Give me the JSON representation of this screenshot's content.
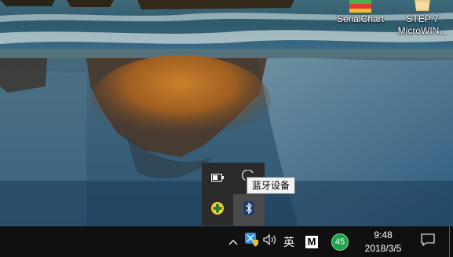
{
  "desktop": {
    "icons": [
      {
        "label": "SerialChart"
      },
      {
        "label_line1": "STEP 7",
        "label_line2": "MicroWIN..."
      }
    ]
  },
  "tray_flyout": {
    "items": [
      "battery-icon",
      "power-ring-icon",
      "green-plus-icon",
      "bluetooth-icon"
    ],
    "tooltip": "蓝牙设备"
  },
  "taskbar": {
    "ime_label": "英",
    "m_label": "M",
    "badge_value": "45",
    "time": "9:48",
    "date": "2018/3/5",
    "colors": {
      "badge": "#1fa34a",
      "taskbar": "#101010",
      "flyout": "#2b2b2b"
    }
  }
}
